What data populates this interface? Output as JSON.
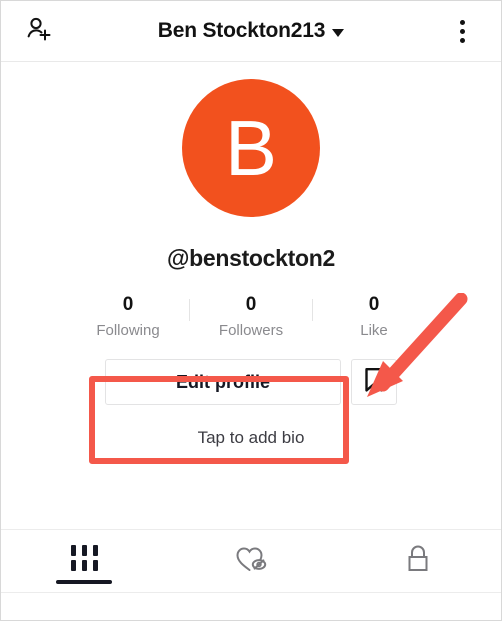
{
  "header": {
    "title": "Ben Stockton213",
    "add_friend_icon": "person-add-icon",
    "dropdown_icon": "chevron-down-icon",
    "menu_icon": "more-vertical-icon"
  },
  "profile": {
    "avatar_initial": "B",
    "avatar_color": "#f2511e",
    "handle": "@benstockton2",
    "bio_placeholder": "Tap to add bio"
  },
  "stats": [
    {
      "value": "0",
      "label": "Following"
    },
    {
      "value": "0",
      "label": "Followers"
    },
    {
      "value": "0",
      "label": "Like"
    }
  ],
  "actions": {
    "edit_profile_label": "Edit profile",
    "bookmark_icon": "bookmark-icon"
  },
  "annotation": {
    "highlight_color": "#f4584a",
    "arrow_color": "#f4584a",
    "target": "Edit profile"
  },
  "tabs": [
    {
      "icon": "grid-icon",
      "active": true
    },
    {
      "icon": "heart-hidden-icon",
      "active": false
    },
    {
      "icon": "lock-icon",
      "active": false
    }
  ]
}
